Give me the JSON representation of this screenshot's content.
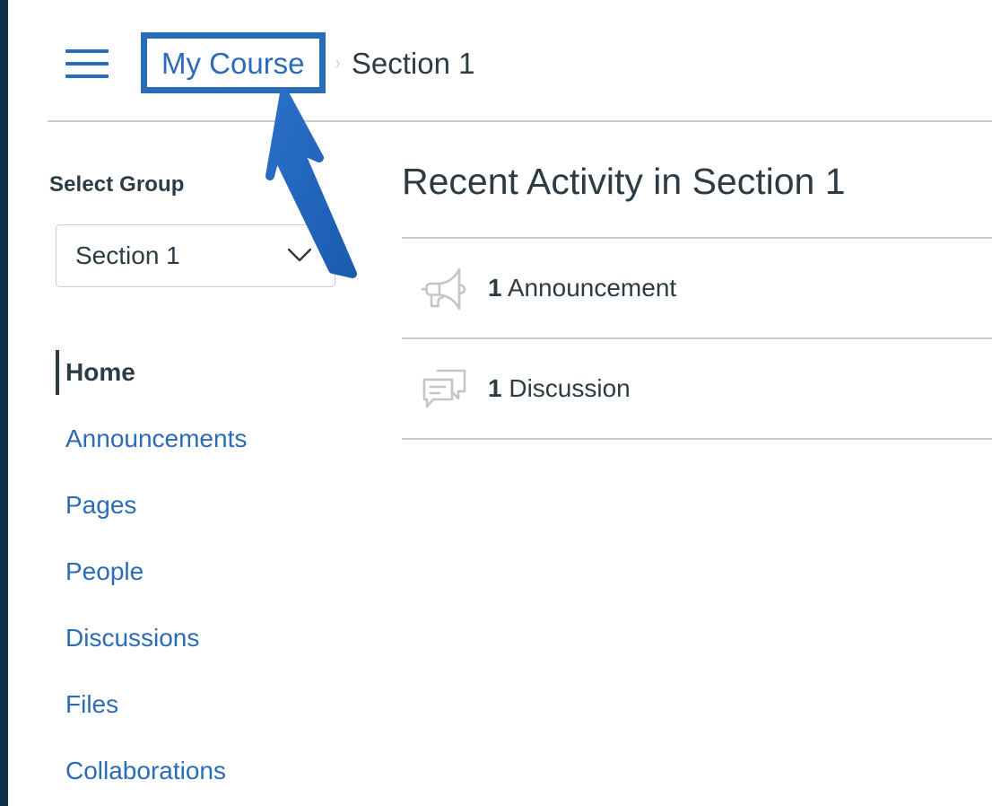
{
  "colors": {
    "global_nav_rail": "#122e4f",
    "link_blue": "#2b6cb8",
    "text_dark": "#2d3b45",
    "border_gray": "#c7cdd1",
    "icon_gray": "#c3c6c9",
    "annotation_blue": "#2063bd"
  },
  "header": {
    "menu_icon": "hamburger-menu-icon",
    "breadcrumb": {
      "course_link": "My Course",
      "separator": "›",
      "current": "Section 1"
    }
  },
  "sidebar": {
    "select_group_label": "Select Group",
    "group_select": {
      "value": "Section 1",
      "chevron_icon": "chevron-down-icon"
    },
    "nav_items": [
      {
        "label": "Home",
        "active": true
      },
      {
        "label": "Announcements",
        "active": false
      },
      {
        "label": "Pages",
        "active": false
      },
      {
        "label": "People",
        "active": false
      },
      {
        "label": "Discussions",
        "active": false
      },
      {
        "label": "Files",
        "active": false
      },
      {
        "label": "Collaborations",
        "active": false
      }
    ]
  },
  "main": {
    "title": "Recent Activity in Section 1",
    "activities": [
      {
        "icon": "megaphone-icon",
        "count": "1",
        "label": " Announcement"
      },
      {
        "icon": "discussion-bubbles-icon",
        "count": "1",
        "label": " Discussion"
      }
    ]
  },
  "annotation": {
    "type": "arrow-pointing-up-left",
    "target": "My Course",
    "highlight_box": "my-course-breadcrumb"
  }
}
